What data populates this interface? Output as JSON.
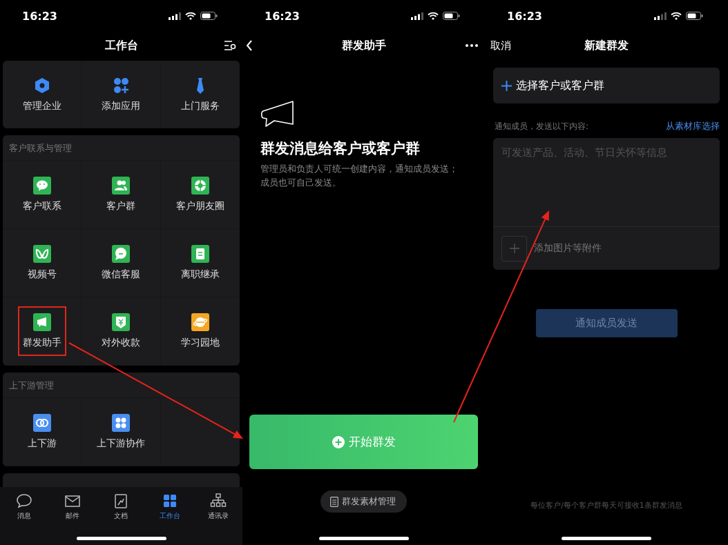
{
  "workbench": {
    "status_bar": {
      "time": "16:23"
    },
    "title": "工作台",
    "sections": [
      {
        "items": [
          {
            "label": "管理企业",
            "highlighted": false
          },
          {
            "label": "添加应用",
            "highlighted": false
          },
          {
            "label": "上门服务",
            "highlighted": false
          }
        ]
      },
      {
        "heading": "客户联系与管理",
        "items": [
          {
            "label": "客户联系",
            "color": "#2fb454",
            "highlighted": false
          },
          {
            "label": "客户群",
            "color": "#2fb454",
            "highlighted": false
          },
          {
            "label": "客户朋友圈",
            "color": "#2fb454",
            "highlighted": false
          },
          {
            "label": "视频号",
            "color": "#2fb454",
            "highlighted": false
          },
          {
            "label": "微信客服",
            "color": "#2fb454",
            "highlighted": false
          },
          {
            "label": "离职继承",
            "color": "#2fb454",
            "highlighted": false
          },
          {
            "label": "群发助手",
            "color": "#2fb454",
            "highlighted": true
          },
          {
            "label": "对外收款",
            "color": "#2fb454",
            "highlighted": false
          },
          {
            "label": "学习园地",
            "color": "#f5a623",
            "highlighted": false
          }
        ]
      },
      {
        "heading": "上下游管理",
        "items": [
          {
            "label": "上下游",
            "color": "#4a8ef0",
            "highlighted": false
          },
          {
            "label": "上下游协作",
            "color": "#4a8ef0",
            "highlighted": false
          }
        ]
      }
    ],
    "tab_bar": [
      {
        "label": "消息",
        "selected": false
      },
      {
        "label": "邮件",
        "selected": false
      },
      {
        "label": "文档",
        "selected": false
      },
      {
        "label": "工作台",
        "selected": true
      },
      {
        "label": "通讯录",
        "selected": false
      }
    ]
  },
  "broadcast_assistant": {
    "status_bar": {
      "time": "16:23"
    },
    "title": "群发助手",
    "heading": "群发消息给客户或客户群",
    "description": "管理员和负责人可统一创建内容，通知成员发送；成员也可自己发送。",
    "start_button": {
      "label": "开始群发"
    },
    "materials_button": {
      "label": "群发素材管理"
    }
  },
  "new_broadcast": {
    "status_bar": {
      "time": "16:23"
    },
    "cancel": "取消",
    "title": "新建群发",
    "select_recipients": {
      "label": "选择客户或客户群"
    },
    "content_label": "通知成员，发送以下内容:",
    "library_link": "从素材库选择",
    "message_field": {
      "placeholder": "可发送产品、活动、节日关怀等信息"
    },
    "attach_label": "添加图片等附件",
    "send_button": {
      "label": "通知成员发送",
      "disabled": true
    },
    "footer_note": "每位客户/每个客户群每天可接收1条群发消息"
  }
}
